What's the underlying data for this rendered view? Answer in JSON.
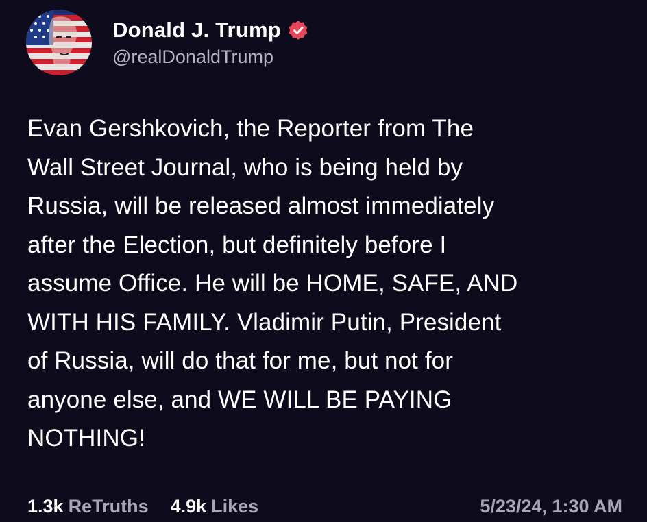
{
  "author": {
    "display_name": "Donald J. Trump",
    "handle": "@realDonaldTrump",
    "verified": true,
    "verified_color": "#e8475a"
  },
  "post": {
    "text": "Evan Gershkovich, the Reporter from The\nWall Street Journal, who is being held by\nRussia, will be released almost immediately\nafter the Election, but definitely before I\nassume Office. He will be HOME, SAFE, AND\nWITH HIS FAMILY. Vladimir Putin, President\nof Russia, will do that for me, but not for\nanyone else, and WE WILL BE PAYING\nNOTHING!"
  },
  "stats": {
    "retruths_count": "1.3k",
    "retruths_label": "ReTruths",
    "likes_count": "4.9k",
    "likes_label": "Likes",
    "timestamp": "5/23/24, 1:30 AM"
  },
  "colors": {
    "background": "#0e0b1c",
    "primary_text": "#ffffff",
    "secondary_text": "#a9a6b6"
  }
}
